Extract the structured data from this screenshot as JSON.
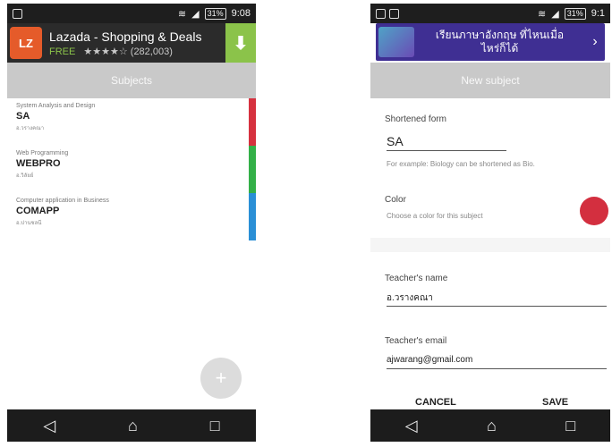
{
  "left": {
    "status": {
      "time": "9:08",
      "battery": "31%"
    },
    "ad": {
      "logo": "LZ",
      "title": "Lazada - Shopping & Deals",
      "free": "FREE",
      "stars": "★★★★☆",
      "count": "(282,003)",
      "install_icon": "download-icon"
    },
    "appbar_title": "Subjects",
    "subjects": [
      {
        "category": "System Analysis and Design",
        "code": "SA",
        "teacher": "อ.วรางคณา",
        "color": "#d6313f"
      },
      {
        "category": "Web Programming",
        "code": "WEBPRO",
        "teacher": "อ.วิลัยย์",
        "color": "#33b048"
      },
      {
        "category": "Computer application in Business",
        "code": "COMAPP",
        "teacher": "อ.ปานชลนี",
        "color": "#2a8fd6"
      }
    ],
    "fab_label": "+",
    "nav": {
      "back": "◁",
      "home": "⌂",
      "recent": "□"
    }
  },
  "right": {
    "status": {
      "time": "9:1",
      "battery": "31%"
    },
    "ad": {
      "line1": "เรียนภาษาอังกฤษ ที่ไหนเมื่อ",
      "line2": "ไหร่ก็ได้",
      "arrow": "›"
    },
    "appbar_title": "New subject",
    "shortened_label": "Shortened form",
    "shortened_value": "SA",
    "shortened_hint": "For example: Biology can be shortened as Bio.",
    "color_label": "Color",
    "color_hint": "Choose a color for this subject",
    "color_value": "#d32f3f",
    "teacher_name_label": "Teacher's name",
    "teacher_name_value": "อ.วรางคณา",
    "teacher_email_label": "Teacher's email",
    "teacher_email_value": "ajwarang@gmail.com",
    "cancel_label": "CANCEL",
    "save_label": "SAVE",
    "nav": {
      "back": "◁",
      "home": "⌂",
      "recent": "□"
    }
  }
}
